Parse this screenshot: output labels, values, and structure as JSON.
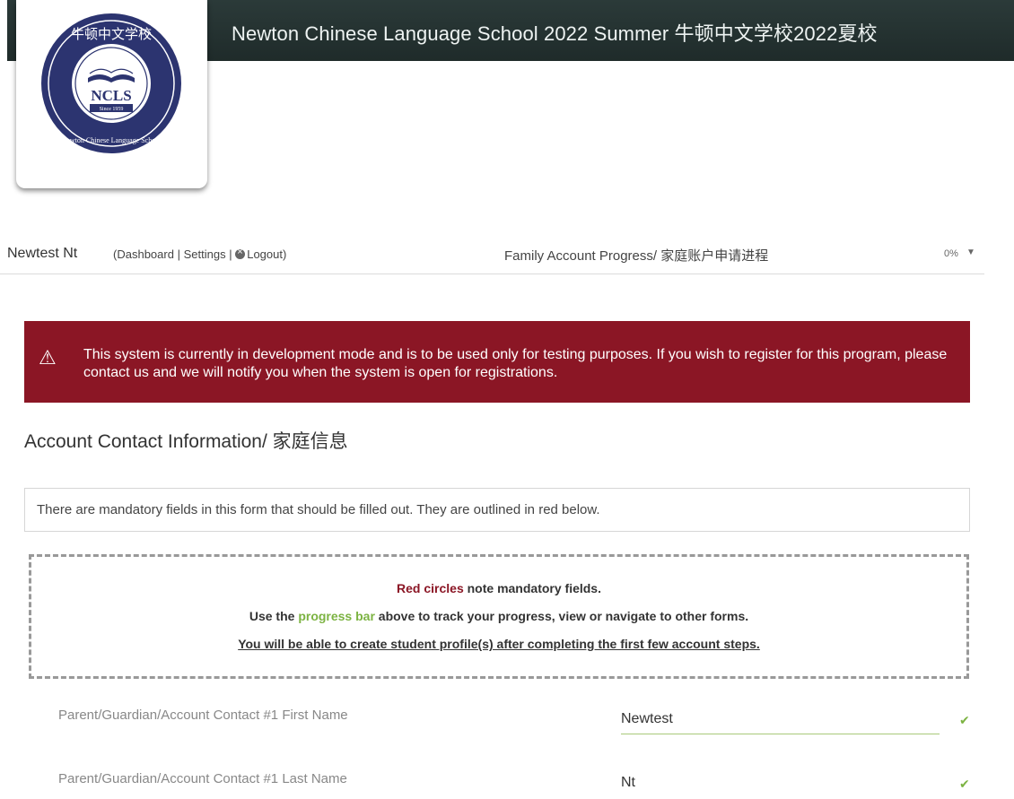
{
  "header": {
    "site_title": "Newton Chinese Language School 2022 Summer 牛顿中文学校2022夏校",
    "logo": {
      "chinese": "牛顿中文学校",
      "abbr": "NCLS",
      "since": "Since 1959",
      "english": "Newton Chinese Language School"
    }
  },
  "user_bar": {
    "name": "Newtest Nt",
    "open_paren": "(",
    "dashboard": "Dashboard",
    "sep1": "|",
    "settings": "Settings",
    "sep2": "|",
    "logout": "Logout",
    "close_paren": ")",
    "progress_title": "Family Account Progress/ 家庭账户申请进程",
    "progress_percent": "0%",
    "progress_value": 0
  },
  "alert": {
    "icon": "warning-triangle-icon",
    "text": "This system is currently in development mode and is to be used only for testing purposes. If you wish to register for this program, please contact us and we will notify you when the system is open for registrations."
  },
  "section": {
    "heading": "Account Contact Information/ 家庭信息"
  },
  "notice": {
    "text": "There are mandatory fields in this form that should be filled out. They are outlined in red below."
  },
  "info_box": {
    "line1_highlight": "Red circles",
    "line1_rest": " note mandatory fields.",
    "line2_pre": "Use the ",
    "line2_highlight": "progress bar",
    "line2_rest": " above to track your progress, view or navigate to other forms.",
    "line3": "You will be able to create student profile(s) after completing the first few account steps."
  },
  "fields": [
    {
      "label": "Parent/Guardian/Account Contact #1 First Name",
      "value": "Newtest"
    },
    {
      "label": "Parent/Guardian/Account Contact #1 Last Name",
      "value": "Nt"
    }
  ],
  "colors": {
    "header_bg": "#24302f",
    "alert_bg": "#8b1625",
    "accent_green": "#7cb342",
    "accent_red": "#8b1625"
  }
}
